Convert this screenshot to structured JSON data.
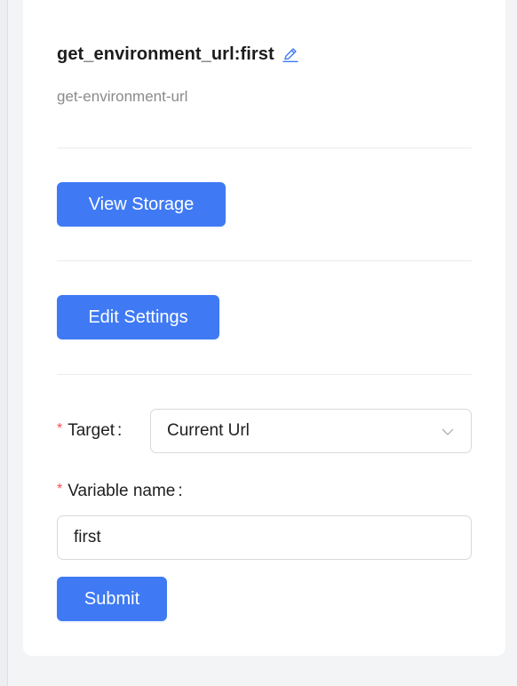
{
  "header": {
    "title": "get_environment_url:first",
    "subtitle": "get-environment-url",
    "edit_icon": "pencil-icon"
  },
  "actions": {
    "view_storage_label": "View Storage",
    "edit_settings_label": "Edit Settings"
  },
  "form": {
    "target": {
      "label": "Target",
      "required_mark": "*",
      "colon": ":",
      "value": "Current Url",
      "icon": "chevron-down-icon"
    },
    "variable_name": {
      "label": "Variable name",
      "required_mark": "*",
      "colon": ":",
      "value": "first"
    },
    "submit_label": "Submit"
  },
  "colors": {
    "primary": "#3f7af4",
    "required": "#ff4d4f",
    "muted_text": "#8a8a8a",
    "icon_accent": "#3f7af4"
  }
}
